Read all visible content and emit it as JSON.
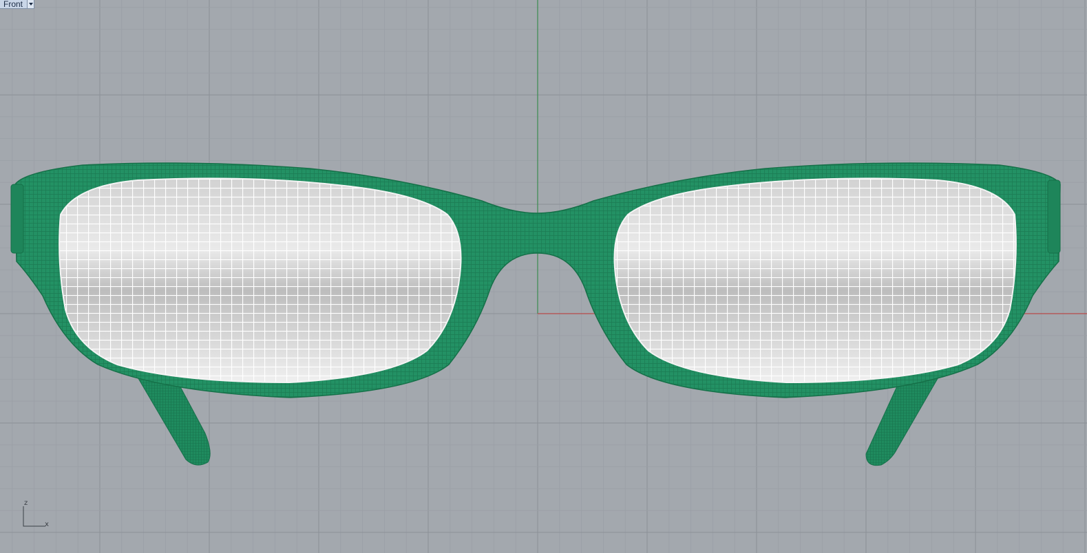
{
  "viewport": {
    "name": "Front",
    "menu_icon": "chevron-down-icon"
  },
  "axis_widget": {
    "up_label": "z",
    "right_label": "x"
  },
  "model": {
    "object": "eyeglasses-mesh",
    "frame_color": "#239164",
    "lens_color": "#e6e6e6",
    "wire_color": "#ffffff"
  },
  "colors": {
    "background": "#a3a8ae",
    "grid_minor": "#9a9fa6",
    "grid_major": "#8b9097",
    "axis_x": "#b84a4a",
    "axis_z": "#3b8a4f"
  }
}
